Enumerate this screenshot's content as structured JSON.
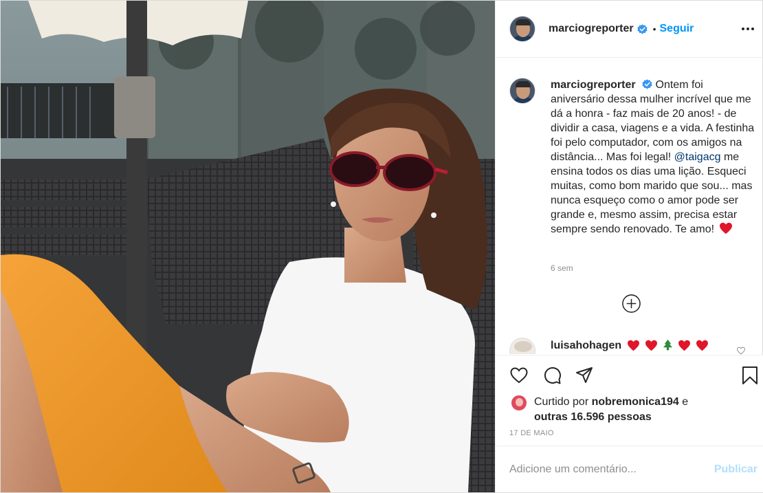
{
  "post": {
    "author": {
      "username": "marciogreporter",
      "verified": true,
      "avatar_icon": "avatar-photo"
    },
    "header": {
      "separator": "•",
      "follow_label": "Seguir",
      "more_icon": "more-options-icon"
    },
    "caption": {
      "username": "marciogreporter",
      "text_before_mention": "Ontem foi aniversário dessa mulher incrível que me dá a honra - faz mais de 20 anos! - de dividir a casa, viagens e a vida. A festinha foi pelo computador, com os amigos na distância... Mas foi legal!",
      "mention": "@taigacg",
      "text_after_mention": "me ensina todos os dias uma lição. Esqueci muitas, como bom marido que sou... mas nunca esqueço como o amor pode ser grande e, mesmo assim, precisa estar sempre sendo renovado. Te amo!",
      "emoji": "red-heart",
      "time_ago": "6 sem"
    },
    "load_more_icon": "plus-circle-icon",
    "comments": [
      {
        "username": "luisahohagen",
        "emojis": [
          "red-heart",
          "red-heart",
          "christmas-tree",
          "red-heart",
          "red-heart"
        ]
      }
    ],
    "actions": {
      "like_icon": "heart-outline-icon",
      "comment_icon": "comment-bubble-icon",
      "share_icon": "paper-plane-icon",
      "save_icon": "bookmark-icon"
    },
    "likes": {
      "prefix": "Curtido por",
      "liked_by": "nobremonica194",
      "connector": "e",
      "others": "outras 16.596 pessoas"
    },
    "date": "17 DE MAIO",
    "add_comment": {
      "placeholder": "Adicione um comentário...",
      "publish_label": "Publicar"
    }
  },
  "colors": {
    "accent": "#0095f6",
    "mention": "#00376b",
    "publish_disabled": "#b2dffc",
    "verified": "#3897f0",
    "heart": "#e0162b",
    "muted": "#8e8e8e"
  }
}
